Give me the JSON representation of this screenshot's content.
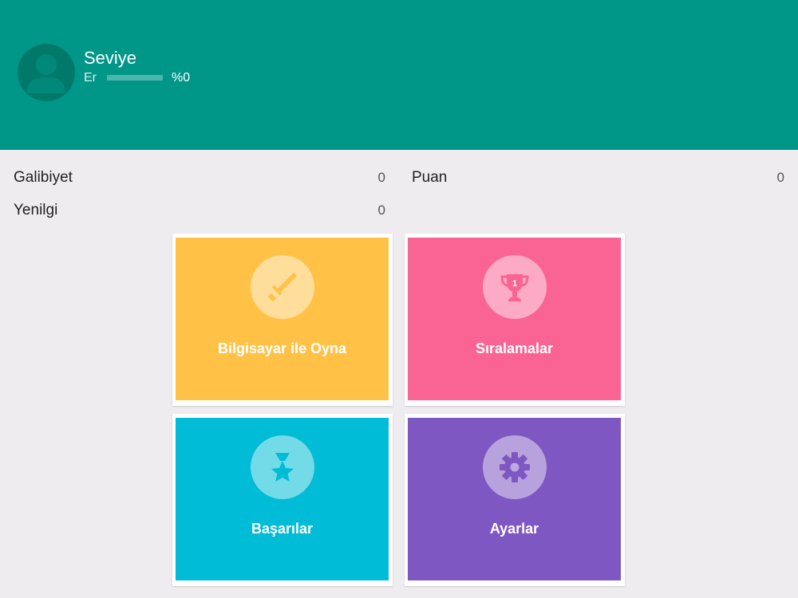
{
  "header": {
    "title": "Seviye",
    "rank": "Er",
    "progress_percent": 0,
    "progress_text": "%0",
    "colors": {
      "background": "#009688",
      "avatar": "#00796b"
    }
  },
  "stats": {
    "wins_label": "Galibiyet",
    "wins_value": "0",
    "losses_label": "Yenilgi",
    "losses_value": "0",
    "points_label": "Puan",
    "points_value": "0"
  },
  "tiles": [
    {
      "label": "Bilgisayar ile Oyna",
      "icon": "sword-icon",
      "color": "#ffc247"
    },
    {
      "label": "Sıralamalar",
      "icon": "trophy-icon",
      "color": "#f96495"
    },
    {
      "label": "Başarılar",
      "icon": "medal-icon",
      "color": "#00bcd6"
    },
    {
      "label": "Ayarlar",
      "icon": "gear-icon",
      "color": "#7e57c2"
    }
  ]
}
